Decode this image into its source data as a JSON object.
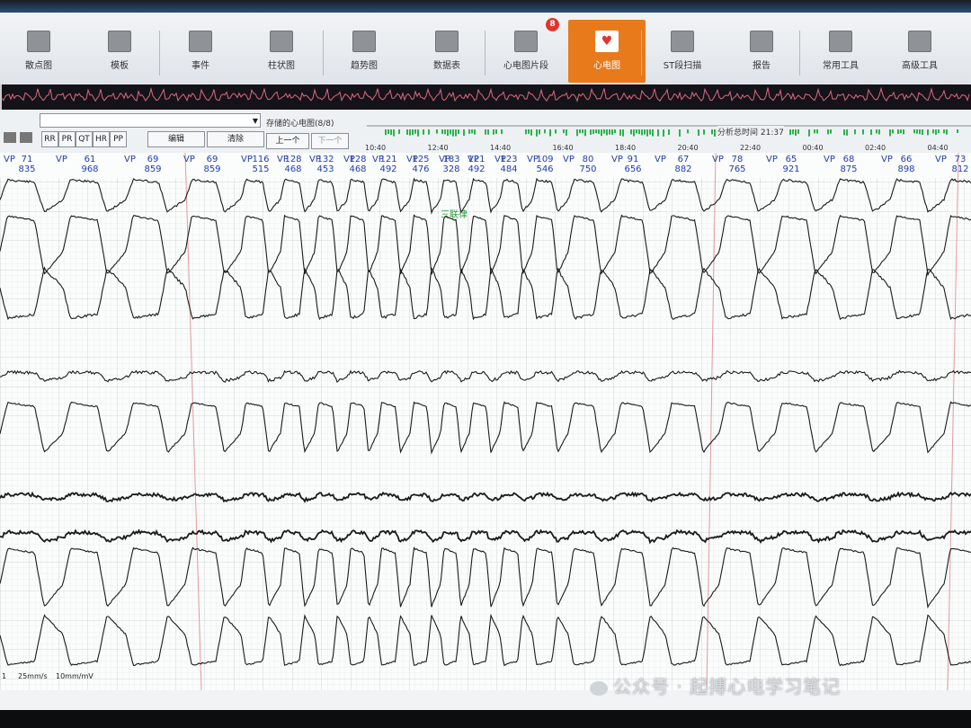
{
  "toolbar": {
    "items": [
      {
        "label": "散点图",
        "icon": "scatter-icon"
      },
      {
        "label": "模板",
        "icon": "template-icon"
      },
      {
        "label": "事件",
        "icon": "event-icon"
      },
      {
        "label": "柱状图",
        "icon": "bar-chart-icon"
      },
      {
        "label": "趋势图",
        "icon": "trend-icon"
      },
      {
        "label": "数据表",
        "icon": "table-icon"
      },
      {
        "label": "心电图片段",
        "icon": "ecg-clip-icon",
        "badge": "8"
      },
      {
        "label": "心电图",
        "icon": "heart-icon",
        "active": true
      },
      {
        "label": "ST段扫描",
        "icon": "st-scan-icon"
      },
      {
        "label": "报告",
        "icon": "report-icon"
      },
      {
        "label": "常用工具",
        "icon": "tools-icon"
      },
      {
        "label": "高级工具",
        "icon": "advanced-tools-icon"
      }
    ],
    "active_color": "#e87a1b"
  },
  "controls": {
    "measure_buttons": [
      "RR",
      "PR",
      "QT",
      "HR",
      "PP"
    ],
    "edit_label": "编辑",
    "delete_label": "清除",
    "stored_ecg_label": "存储的心电图(8/8)",
    "prev_label": "上一个",
    "next_label": "下一个",
    "analysis_time": "分析总时间 21:37",
    "timeline_ticks": [
      "10:40",
      "12:40",
      "14:40",
      "16:40",
      "18:40",
      "20:40",
      "22:40",
      "00:40",
      "02:40",
      "04:40"
    ]
  },
  "annotation_label": "三联律",
  "beats": [
    {
      "hr": "71",
      "rr": "835"
    },
    {
      "hr": "61",
      "rr": "968"
    },
    {
      "hr": "69",
      "rr": "859"
    },
    {
      "hr": "69",
      "rr": "859"
    },
    {
      "hr": "116",
      "rr": "515"
    },
    {
      "hr": "128",
      "rr": "468"
    },
    {
      "hr": "132",
      "rr": "453"
    },
    {
      "hr": "128",
      "rr": "468"
    },
    {
      "hr": "121",
      "rr": "492"
    },
    {
      "hr": "125",
      "rr": "476"
    },
    {
      "hr": "183",
      "rr": "328"
    },
    {
      "hr": "121",
      "rr": "492"
    },
    {
      "hr": "123",
      "rr": "484"
    },
    {
      "hr": "109",
      "rr": "546"
    },
    {
      "hr": "80",
      "rr": "750"
    },
    {
      "hr": "91",
      "rr": "656"
    },
    {
      "hr": "67",
      "rr": "882"
    },
    {
      "hr": "78",
      "rr": "765"
    },
    {
      "hr": "65",
      "rr": "921"
    },
    {
      "hr": "68",
      "rr": "875"
    },
    {
      "hr": "66",
      "rr": "898"
    },
    {
      "hr": "73",
      "rr": "812"
    }
  ],
  "beat_type": "VP",
  "status": {
    "speed": "25mm/s",
    "gain": "10mm/mV",
    "lead_index": "1"
  },
  "watermark": "公众号 · 起搏心电学习笔记"
}
